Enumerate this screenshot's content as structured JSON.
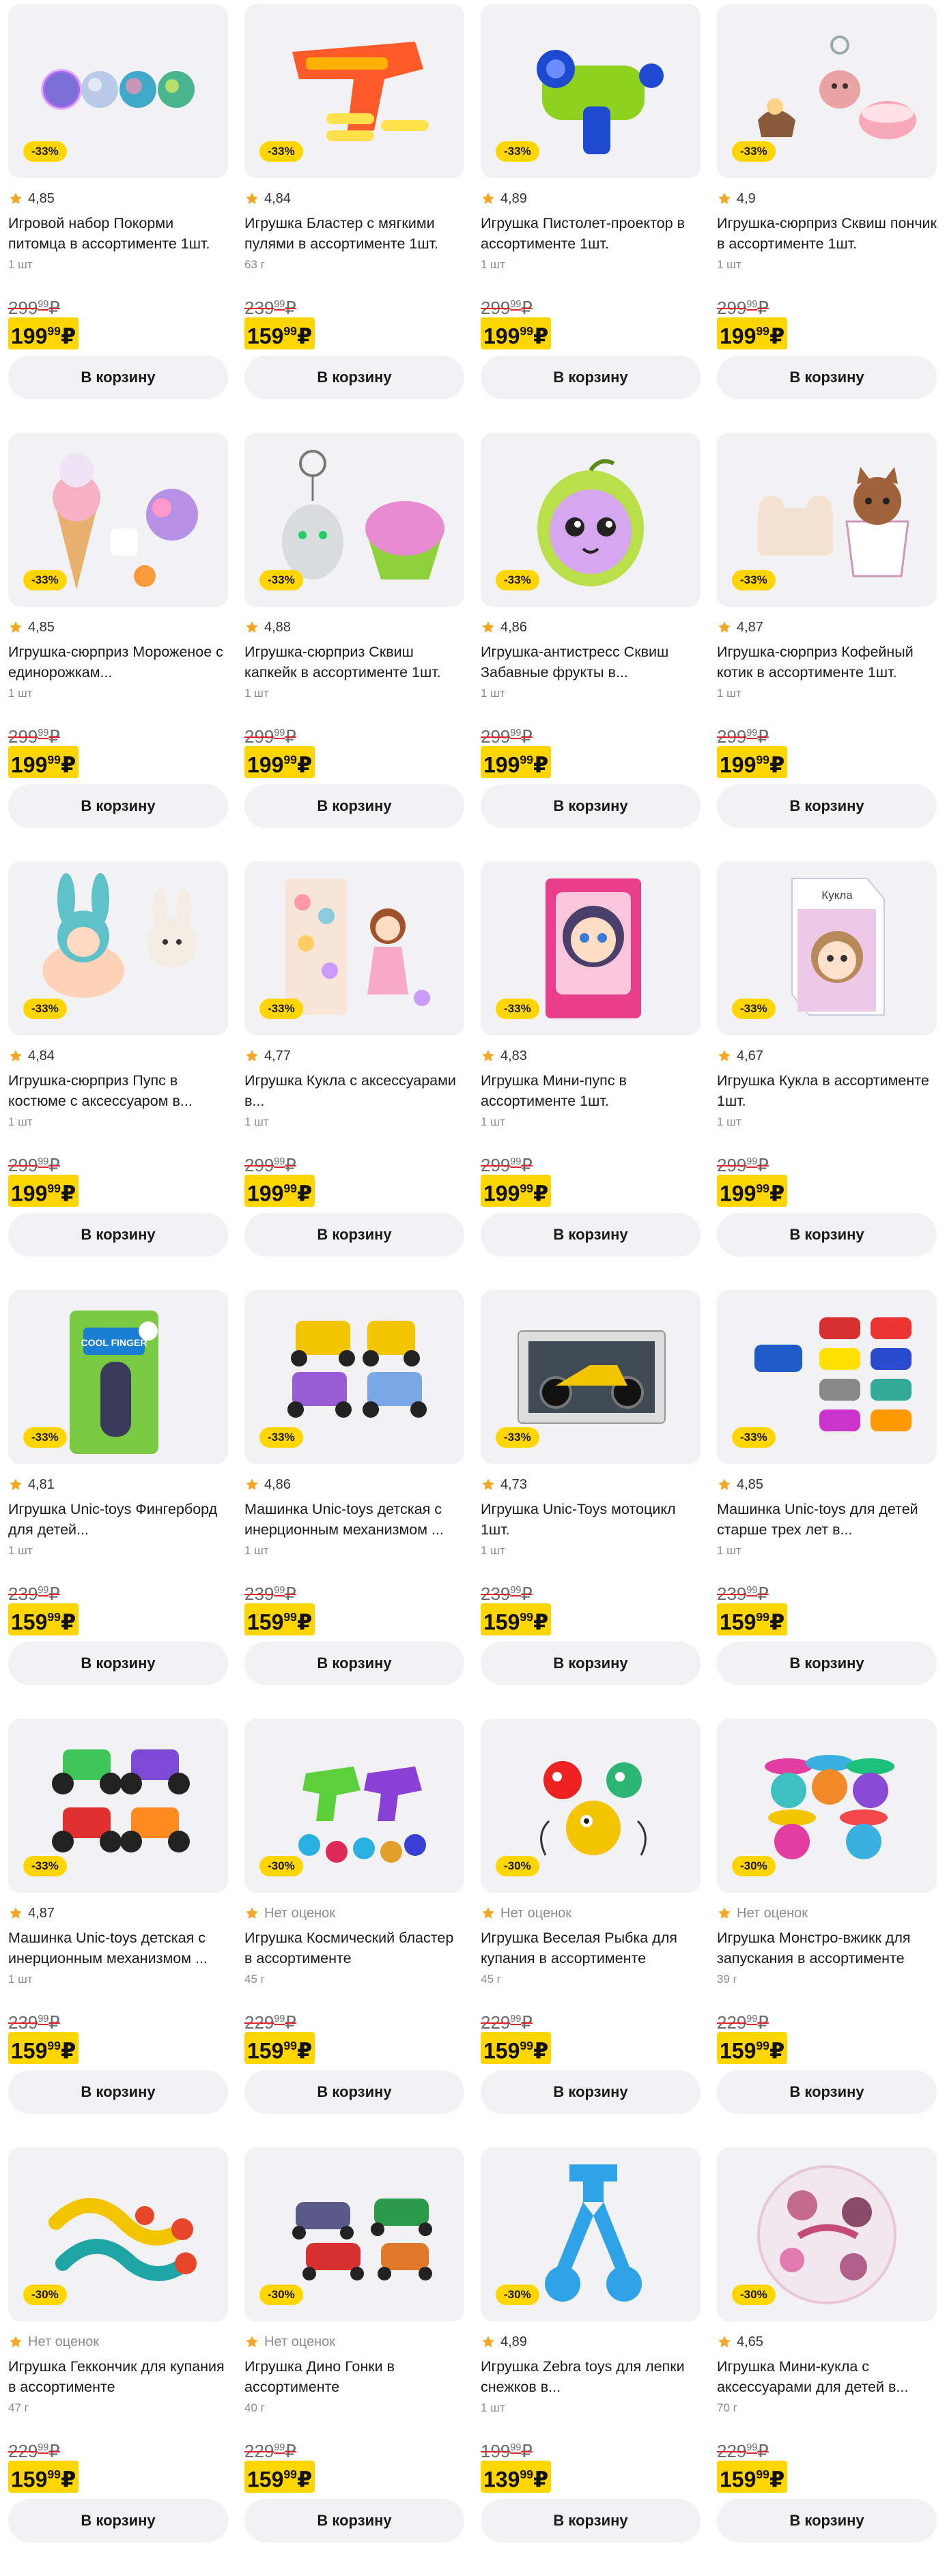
{
  "cart_label": "В корзину",
  "currency": "₽",
  "products": [
    {
      "rating": "4,85",
      "title": "Игровой набор Покорми питомца в ассортименте 1шт.",
      "unit": "1 шт",
      "discount": "-33%",
      "old_price": "299",
      "old_cents": "99",
      "new_price": "199",
      "new_cents": "99",
      "image": "balls"
    },
    {
      "rating": "4,84",
      "title": "Игрушка Бластер с мягкими пулями в ассортименте 1шт.",
      "unit": "63 г",
      "discount": "-33%",
      "old_price": "239",
      "old_cents": "99",
      "new_price": "159",
      "new_cents": "99",
      "image": "blaster"
    },
    {
      "rating": "4,89",
      "title": "Игрушка Пистолет-проектор в ассортименте 1шт.",
      "unit": "1 шт",
      "discount": "-33%",
      "old_price": "299",
      "old_cents": "99",
      "new_price": "199",
      "new_cents": "99",
      "image": "projector"
    },
    {
      "rating": "4,9",
      "title": "Игрушка-сюрприз Сквиш пончик в ассортименте 1шт.",
      "unit": "1 шт",
      "discount": "-33%",
      "old_price": "299",
      "old_cents": "99",
      "new_price": "199",
      "new_cents": "99",
      "image": "donut"
    },
    {
      "rating": "4,85",
      "title": "Игрушка-сюрприз Мороженое с единорожкам...",
      "unit": "1 шт",
      "discount": "-33%",
      "old_price": "299",
      "old_cents": "99",
      "new_price": "199",
      "new_cents": "99",
      "image": "icecream"
    },
    {
      "rating": "4,88",
      "title": "Игрушка-сюрприз Сквиш капкейк в ассортименте 1шт.",
      "unit": "1 шт",
      "discount": "-33%",
      "old_price": "299",
      "old_cents": "99",
      "new_price": "199",
      "new_cents": "99",
      "image": "cupcake"
    },
    {
      "rating": "4,86",
      "title": "Игрушка-антистресс Сквиш Забавные фрукты в...",
      "unit": "1 шт",
      "discount": "-33%",
      "old_price": "299",
      "old_cents": "99",
      "new_price": "199",
      "new_cents": "99",
      "image": "fruit"
    },
    {
      "rating": "4,87",
      "title": "Игрушка-сюрприз Кофейный котик в ассортименте 1шт.",
      "unit": "1 шт",
      "discount": "-33%",
      "old_price": "299",
      "old_cents": "99",
      "new_price": "199",
      "new_cents": "99",
      "image": "cat"
    },
    {
      "rating": "4,84",
      "title": "Игрушка-сюрприз Пупс в костюме с аксессуаром в...",
      "unit": "1 шт",
      "discount": "-33%",
      "old_price": "299",
      "old_cents": "99",
      "new_price": "199",
      "new_cents": "99",
      "image": "bunny"
    },
    {
      "rating": "4,77",
      "title": "Игрушка Кукла с аксессуарами в...",
      "unit": "1 шт",
      "discount": "-33%",
      "old_price": "299",
      "old_cents": "99",
      "new_price": "199",
      "new_cents": "99",
      "image": "doll"
    },
    {
      "rating": "4,83",
      "title": "Игрушка Мини-пупс в ассортименте 1шт.",
      "unit": "1 шт",
      "discount": "-33%",
      "old_price": "299",
      "old_cents": "99",
      "new_price": "199",
      "new_cents": "99",
      "image": "minidoll"
    },
    {
      "rating": "4,67",
      "title": "Игрушка Кукла в ассортименте 1шт.",
      "unit": "1 шт",
      "discount": "-33%",
      "old_price": "299",
      "old_cents": "99",
      "new_price": "199",
      "new_cents": "99",
      "image": "dollbox",
      "box_text": "Кукла"
    },
    {
      "rating": "4,81",
      "title": "Игрушка Unic-toys Фингерборд для детей...",
      "unit": "1 шт",
      "discount": "-33%",
      "old_price": "239",
      "old_cents": "99",
      "new_price": "159",
      "new_cents": "99",
      "image": "fingerboard",
      "box_text": "COOL FINGER"
    },
    {
      "rating": "4,86",
      "title": "Машинка Unic-toys детская с инерционным механизмом ...",
      "unit": "1 шт",
      "discount": "-33%",
      "old_price": "239",
      "old_cents": "99",
      "new_price": "159",
      "new_cents": "99",
      "image": "cars"
    },
    {
      "rating": "4,73",
      "title": "Игрушка Unic-Toys мотоцикл 1шт.",
      "unit": "1 шт",
      "discount": "-33%",
      "old_price": "239",
      "old_cents": "99",
      "new_price": "159",
      "new_cents": "99",
      "image": "moto"
    },
    {
      "rating": "4,85",
      "title": "Машинка Unic-toys для детей старше трех лет в...",
      "unit": "1 шт",
      "discount": "-33%",
      "old_price": "239",
      "old_cents": "99",
      "new_price": "159",
      "new_cents": "99",
      "image": "minicars"
    },
    {
      "rating": "4,87",
      "title": "Машинка Unic-toys детская с инерционным механизмом ...",
      "unit": "1 шт",
      "discount": "-33%",
      "old_price": "239",
      "old_cents": "99",
      "new_price": "159",
      "new_cents": "99",
      "image": "monstertrucks"
    },
    {
      "rating": "Нет оценок",
      "title": "Игрушка Космический бластер в ассортименте",
      "unit": "45 г",
      "discount": "-30%",
      "old_price": "229",
      "old_cents": "99",
      "new_price": "159",
      "new_cents": "99",
      "image": "spaceblaster",
      "no_rating": true
    },
    {
      "rating": "Нет оценок",
      "title": "Игрушка Веселая Рыбка для купания в ассортименте",
      "unit": "45 г",
      "discount": "-30%",
      "old_price": "229",
      "old_cents": "99",
      "new_price": "159",
      "new_cents": "99",
      "image": "fish",
      "no_rating": true
    },
    {
      "rating": "Нет оценок",
      "title": "Игрушка Монстро-вжикк для запускания в ассортименте",
      "unit": "39 г",
      "discount": "-30%",
      "old_price": "229",
      "old_cents": "99",
      "new_price": "159",
      "new_cents": "99",
      "image": "spinners",
      "no_rating": true
    },
    {
      "rating": "Нет оценок",
      "title": "Игрушка Геккончик для купания в ассортименте",
      "unit": "47 г",
      "discount": "-30%",
      "old_price": "229",
      "old_cents": "99",
      "new_price": "159",
      "new_cents": "99",
      "image": "gecko",
      "no_rating": true
    },
    {
      "rating": "Нет оценок",
      "title": "Игрушка Дино Гонки в ассортименте",
      "unit": "40 г",
      "discount": "-30%",
      "old_price": "229",
      "old_cents": "99",
      "new_price": "159",
      "new_cents": "99",
      "image": "dino",
      "no_rating": true
    },
    {
      "rating": "4,89",
      "title": "Игрушка Zebra toys для лепки снежков в...",
      "unit": "1 шт",
      "discount": "-30%",
      "old_price": "199",
      "old_cents": "99",
      "new_price": "139",
      "new_cents": "99",
      "image": "snowball"
    },
    {
      "rating": "4,65",
      "title": "Игрушка Мини-кукла с аксессуарами для детей в...",
      "unit": "70 г",
      "discount": "-30%",
      "old_price": "229",
      "old_cents": "99",
      "new_price": "159",
      "new_cents": "99",
      "image": "ball"
    }
  ],
  "colors": {
    "accent_yellow": "#ffd500",
    "card_bg": "#f2f2f4",
    "star": "#f5a623",
    "star_empty": "#f0a040",
    "strike": "#e0262b"
  }
}
